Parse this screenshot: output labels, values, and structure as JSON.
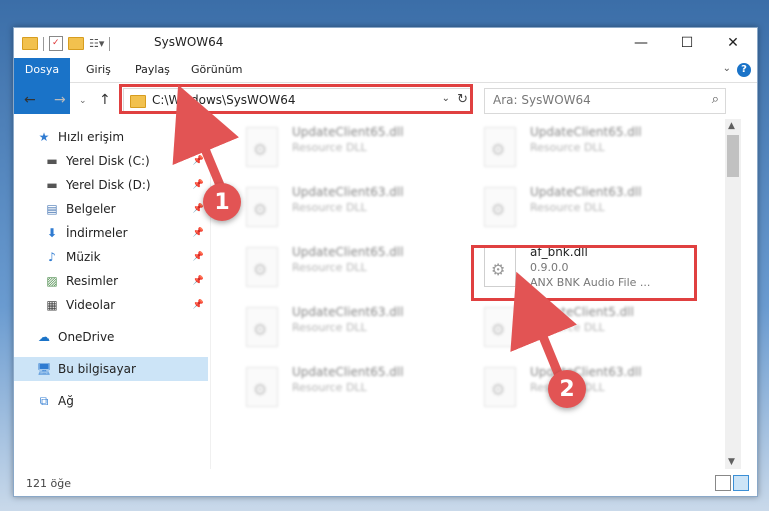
{
  "window": {
    "title": "SysWOW64",
    "controls": {
      "minimize": "—",
      "maximize": "☐",
      "close": "✕"
    }
  },
  "ribbon": {
    "tabs": [
      "Dosya",
      "Giriş",
      "Paylaş",
      "Görünüm"
    ],
    "help": "?"
  },
  "nav": {
    "address": "C:\\Windows\\SysWOW64",
    "search_placeholder": "Ara: SysWOW64"
  },
  "sidebar": {
    "items": [
      {
        "label": "Hızlı erişim",
        "icon": "star-icon"
      },
      {
        "label": "Yerel Disk (C:)",
        "icon": "drive-icon"
      },
      {
        "label": "Yerel Disk (D:)",
        "icon": "drive-icon"
      },
      {
        "label": "Belgeler",
        "icon": "documents-icon"
      },
      {
        "label": "İndirmeler",
        "icon": "download-icon"
      },
      {
        "label": "Müzik",
        "icon": "music-icon"
      },
      {
        "label": "Resimler",
        "icon": "pictures-icon"
      },
      {
        "label": "Videolar",
        "icon": "video-icon"
      },
      {
        "label": "OneDrive",
        "icon": "cloud-icon"
      },
      {
        "label": "Bu bilgisayar",
        "icon": "computer-icon"
      },
      {
        "label": "Ağ",
        "icon": "network-icon"
      }
    ]
  },
  "files": [
    {
      "name": "UpdateClient65.dll",
      "type": "Resource DLL"
    },
    {
      "name": "UpdateClient65.dll",
      "type": "Resource DLL"
    },
    {
      "name": "UpdateClient63.dll",
      "type": "Resource DLL"
    },
    {
      "name": "UpdateClient63.dll",
      "type": "Resource DLL"
    },
    {
      "name": "UpdateClient65.dll",
      "type": "Resource DLL"
    },
    {
      "name": "af_bnk.dll",
      "version": "0.9.0.0",
      "description": "ANX BNK Audio File ..."
    },
    {
      "name": "UpdateClient63.dll",
      "type": "Resource DLL"
    },
    {
      "name": "UpdateClient5.dll",
      "type": "Resource DLL"
    },
    {
      "name": "UpdateClient65.dll",
      "type": "Resource DLL"
    },
    {
      "name": "UpdateClient63.dll",
      "type": "Resource DLL"
    }
  ],
  "status": {
    "count": "121 öğe"
  },
  "annotations": {
    "step1": "1",
    "step2": "2",
    "color": "#e25454"
  }
}
